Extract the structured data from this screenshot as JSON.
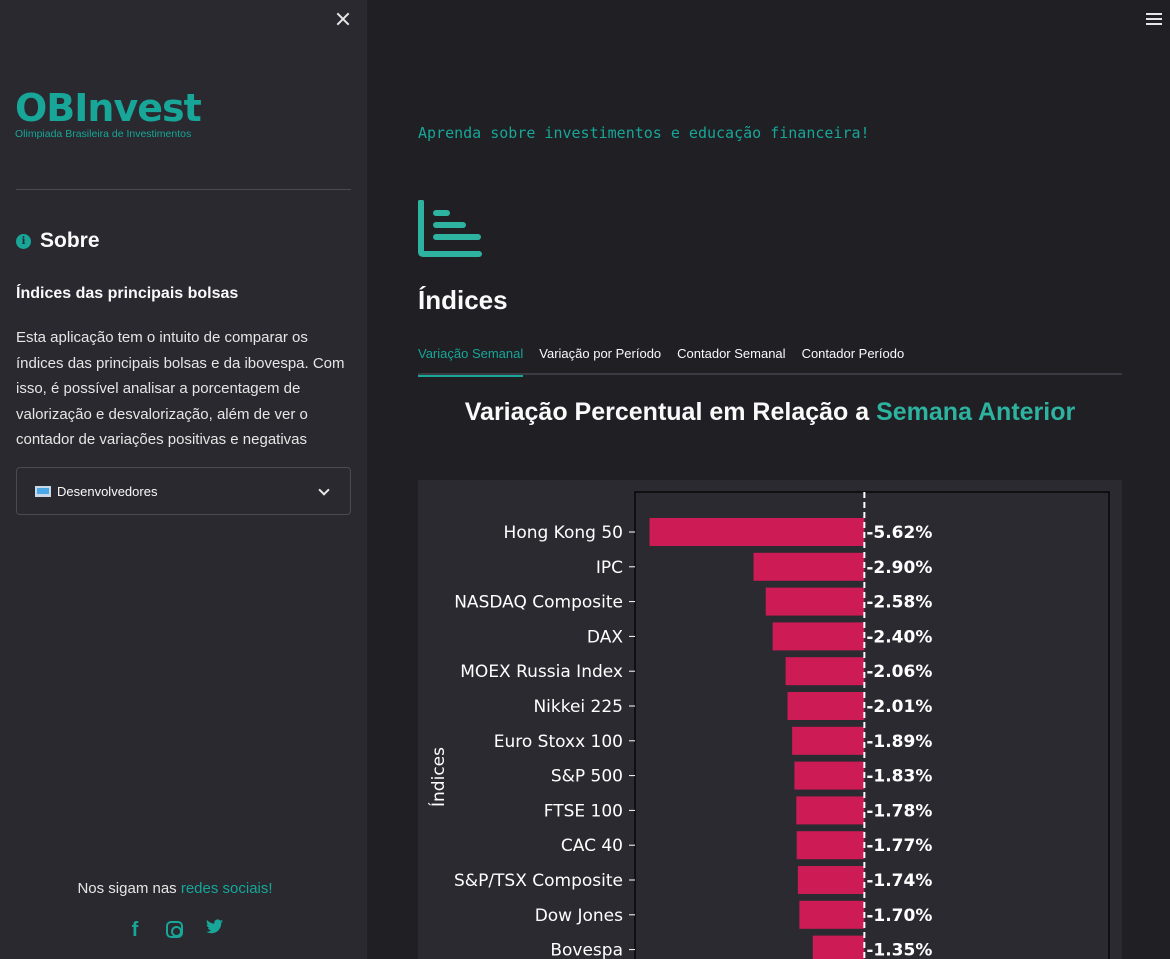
{
  "sidebar": {
    "logo": {
      "main": "OBInvest",
      "sub": "Olimpiada Brasileira de Investimentos"
    },
    "section_title": "Sobre",
    "heading": "Índices das principais bolsas",
    "description": "Esta aplicação tem o intuito de comparar os índices das principais bolsas e da ibovespa. Com isso, é possível analisar a porcentagem de valorização e desvalorização, além de ver o contador de variações positivas e negativas",
    "expander_label": "Desenvolvedores",
    "social_prefix": "Nos sigam nas ",
    "social_link": "redes sociais!",
    "social_icons": [
      "facebook-icon",
      "instagram-icon",
      "twitter-icon"
    ]
  },
  "main": {
    "tagline": "Aprenda sobre investimentos e educação financeira!",
    "title": "Índices",
    "tabs": [
      {
        "label": "Variação Semanal",
        "active": true
      },
      {
        "label": "Variação por Período",
        "active": false
      },
      {
        "label": "Contador Semanal",
        "active": false
      },
      {
        "label": "Contador Período",
        "active": false
      }
    ],
    "chart_title_prefix": "Variação Percentual em Relação a ",
    "chart_title_accent": "Semana Anterior"
  },
  "colors": {
    "accent": "#17a698",
    "bar": "#cc1b55",
    "sidebar_bg": "#29292f",
    "main_bg": "#1f1f24"
  },
  "chart_data": {
    "type": "bar",
    "orientation": "horizontal",
    "ylabel": "Índices",
    "categories": [
      "Hong Kong 50",
      "IPC",
      "NASDAQ Composite",
      "DAX",
      "MOEX Russia Index",
      "Nikkei 225",
      "Euro Stoxx 100",
      "S&P 500",
      "FTSE 100",
      "CAC 40",
      "S&P/TSX Composite",
      "Dow Jones",
      "Bovespa"
    ],
    "values": [
      -5.62,
      -2.9,
      -2.58,
      -2.4,
      -2.06,
      -2.01,
      -1.89,
      -1.83,
      -1.78,
      -1.77,
      -1.74,
      -1.7,
      -1.35
    ],
    "data_labels": [
      "-5.62%",
      "-2.90%",
      "-2.58%",
      "-2.40%",
      "-2.06%",
      "-2.01%",
      "-1.89%",
      "-1.83%",
      "-1.78%",
      "-1.77%",
      "-1.74%",
      "-1.70%",
      "-1.35%"
    ],
    "xlim": [
      -6.0,
      6.4
    ],
    "reference_line": 0
  }
}
